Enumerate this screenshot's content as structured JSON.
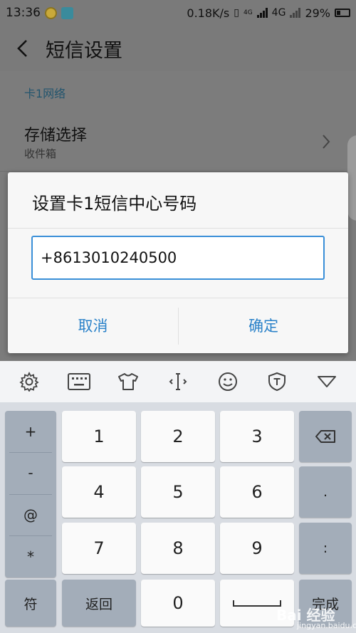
{
  "status_bar": {
    "time": "13:36",
    "speed": "0.18K/s",
    "net_small": "4G",
    "network": "4G",
    "battery": "29%"
  },
  "header": {
    "title": "短信设置",
    "back_icon": "back-arrow-icon"
  },
  "settings": {
    "section": "卡1网络",
    "item_title": "存储选择",
    "item_value": "收件箱"
  },
  "dialog": {
    "title": "设置卡1短信中心号码",
    "input_value": "+8613010240500",
    "cancel": "取消",
    "confirm": "确定"
  },
  "toolbar": {
    "icons": [
      "gear-icon",
      "keyboard-icon",
      "tshirt-icon",
      "cursor-icon",
      "smiley-icon",
      "shield-t-icon",
      "collapse-icon"
    ]
  },
  "keyboard": {
    "symbols": [
      "+",
      "-",
      "@",
      "*"
    ],
    "digits": [
      "1",
      "2",
      "3",
      "4",
      "5",
      "6",
      "7",
      "8",
      "9",
      "0"
    ],
    "period": ".",
    "colon": ":",
    "symbol_switch": "符",
    "return": "返回",
    "done": "完成",
    "backspace_icon": "backspace-icon",
    "space_icon": "space-icon"
  },
  "watermark": {
    "brand": "Bai 经验",
    "url": "jingyan.baidu.com"
  }
}
